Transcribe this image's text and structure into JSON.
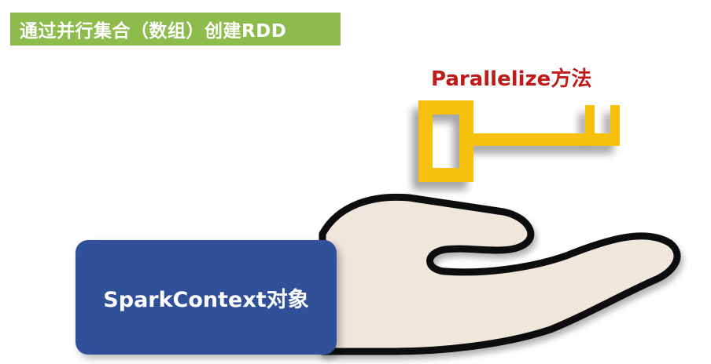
{
  "header": {
    "title": "通过并行集合（数组）创建RDD"
  },
  "key": {
    "label": "Parallelize方法"
  },
  "hand": {
    "box_label": "SparkContext对象"
  },
  "colors": {
    "title_bg": "#8dbb4c",
    "title_text": "#ffffff",
    "key_label": "#c01b1b",
    "key_fill": "#f5c10e",
    "hand_fill": "#efe6dc",
    "hand_outline": "#111111",
    "box_fill": "#30519a"
  },
  "icons": [
    "key-icon",
    "hand-icon"
  ]
}
